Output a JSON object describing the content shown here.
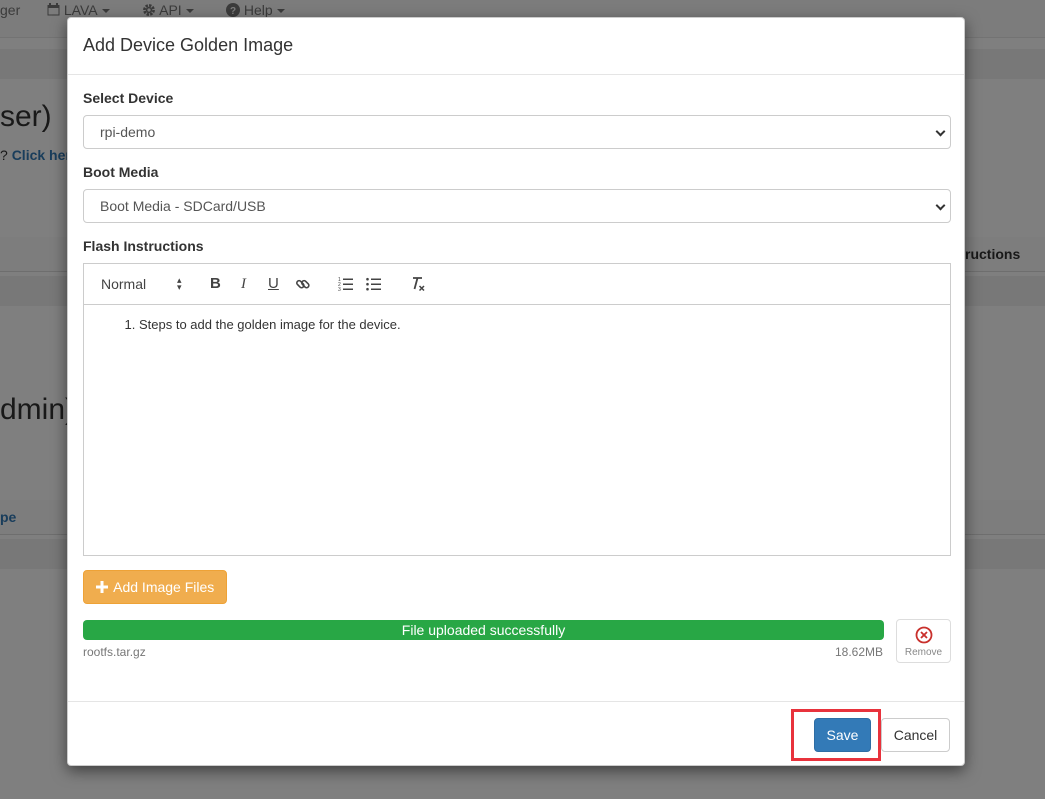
{
  "background": {
    "nav": [
      {
        "icon": "",
        "label": "ger"
      },
      {
        "icon": "calendar-icon",
        "label": "LAVA"
      },
      {
        "icon": "gear-icon",
        "label": "API"
      },
      {
        "icon": "question-circle-icon",
        "label": "Help"
      }
    ],
    "heading_user": "ser)",
    "click_here_prefix": "?",
    "click_here_link": "Click her",
    "table_header_right": "ructions",
    "heading_admin": "dmin)",
    "table_header_left": "pe"
  },
  "modal": {
    "title": "Add Device Golden Image",
    "select_device": {
      "label": "Select Device",
      "value": "rpi-demo"
    },
    "boot_media": {
      "label": "Boot Media",
      "value": "Boot Media - SDCard/USB"
    },
    "flash_instructions": {
      "label": "Flash Instructions",
      "format_value": "Normal",
      "items": [
        "Steps to add the golden image for the device."
      ]
    },
    "add_files_label": "Add Image Files",
    "upload": {
      "status": "File uploaded successfully",
      "progress_percent": 100,
      "file_name": "rootfs.tar.gz",
      "file_size": "18.62MB",
      "remove_label": "Remove"
    },
    "footer": {
      "save_label": "Save",
      "cancel_label": "Cancel"
    }
  },
  "colors": {
    "primary": "#337ab7",
    "warning": "#f0ad4e",
    "success": "#28a745",
    "highlight": "#e8323c"
  }
}
